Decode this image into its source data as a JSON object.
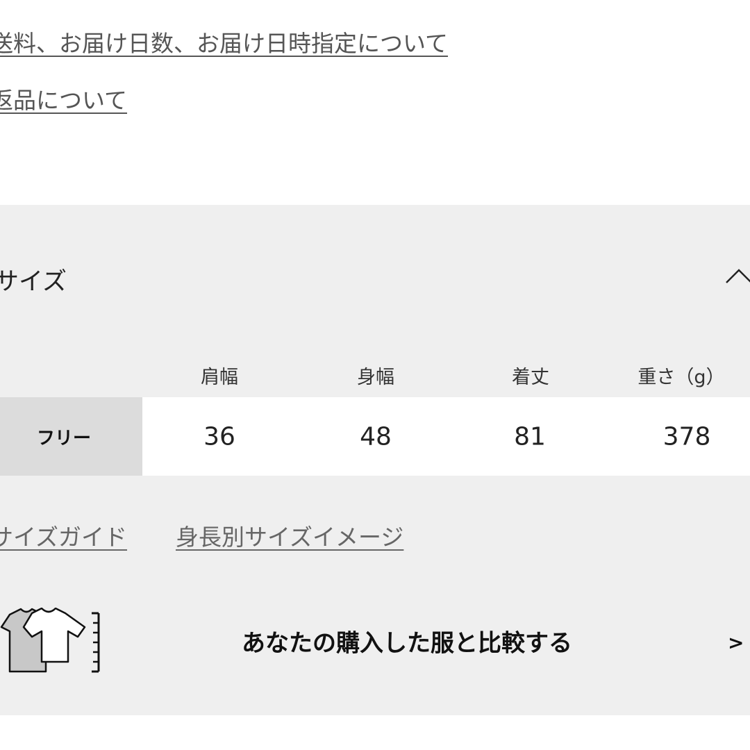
{
  "links": {
    "shipping": "送料、お届け日数、お届け日時指定について",
    "returns": "返品について"
  },
  "size_section": {
    "title": "サイズ",
    "chevron_icon": "chevron-up-icon",
    "columns": [
      "肩幅",
      "身幅",
      "着丈",
      "重さ（g）"
    ],
    "rows": [
      {
        "label": "フリー",
        "values": [
          "36",
          "48",
          "81",
          "378"
        ]
      }
    ],
    "guide_links": {
      "size_guide": "サイズガイド",
      "height_image": "身長別サイズイメージ"
    },
    "compare": {
      "icon": "tshirt-compare-icon",
      "label": "あなたの購入した服と比較する",
      "arrow": ">"
    }
  },
  "colors": {
    "panel_background": "#efefef",
    "label_cell_background": "#dcdcdc",
    "link_text": "#555555"
  }
}
